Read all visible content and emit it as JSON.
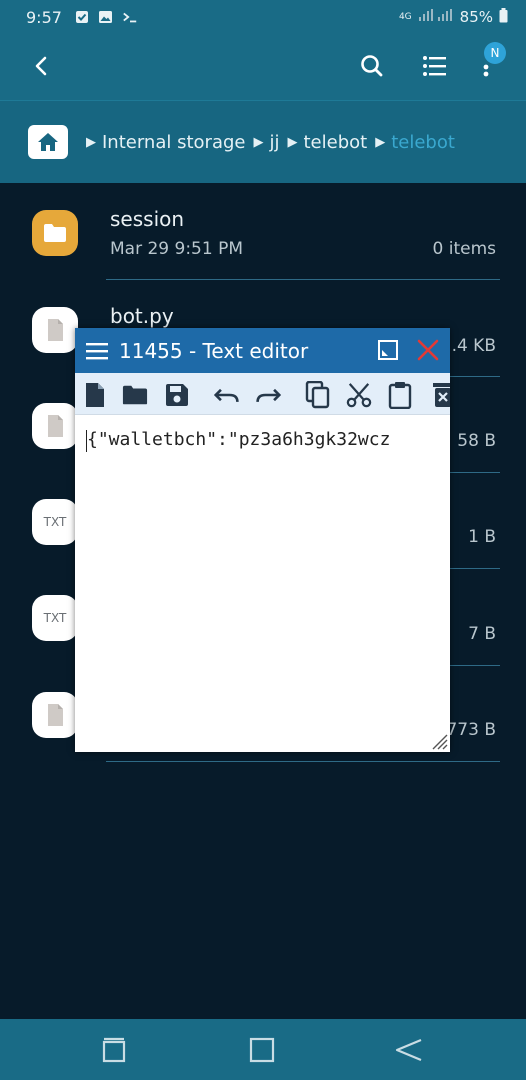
{
  "status_bar": {
    "time": "9:57",
    "network": "4G",
    "battery": "85%"
  },
  "app_bar": {
    "badge": "N"
  },
  "breadcrumb": {
    "items": [
      "Internal storage",
      "jj",
      "telebot",
      "telebot"
    ]
  },
  "files": [
    {
      "name": "session",
      "date": "Mar 29 9:51 PM",
      "size": "0 items",
      "icon": "folder-icon"
    },
    {
      "name": "bot.py",
      "date": "",
      "size": ".4 KB",
      "icon": "file-icon"
    },
    {
      "name": "",
      "date": "",
      "size": "58 B",
      "icon": "file-icon"
    },
    {
      "name": "",
      "date": "",
      "size": "1 B",
      "icon": "txt-icon",
      "icon_text": "TXT"
    },
    {
      "name": "",
      "date": "",
      "size": "7 B",
      "icon": "txt-icon",
      "icon_text": "TXT"
    },
    {
      "name": "",
      "date": "",
      "size": "773 B",
      "icon": "file-icon"
    }
  ],
  "editor": {
    "title": "11455 - Text editor",
    "content": "{\"walletbch\":\"pz3a6h3gk32wcz",
    "toolbar": [
      "new-file-icon",
      "open-folder-icon",
      "save-icon",
      "undo-icon",
      "redo-icon",
      "copy-icon",
      "cut-icon",
      "paste-icon",
      "delete-icon"
    ]
  },
  "colors": {
    "appbar": "#196b86",
    "background": "#071b2a",
    "editor_title": "#1e6aa8",
    "folder": "#e6a83a",
    "close": "#e53935"
  }
}
